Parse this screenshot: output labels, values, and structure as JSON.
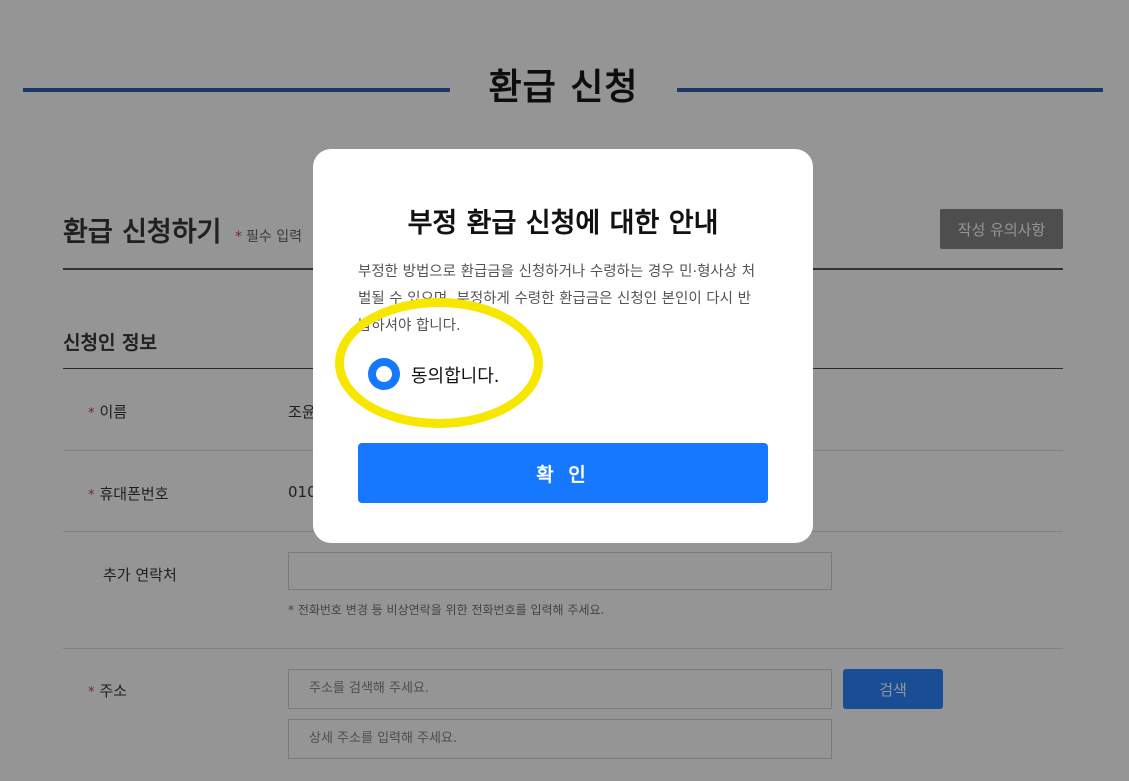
{
  "page": {
    "title": "환급 신청",
    "section_title": "환급 신청하기",
    "required_star": "*",
    "required_note": "필수 입력",
    "notice_button": "작성 유의사항",
    "subsection_title": "신청인 정보"
  },
  "form": {
    "name": {
      "label": "이름",
      "value": "조윤"
    },
    "phone": {
      "label": "휴대폰번호",
      "value": "010"
    },
    "extra_contact": {
      "label": "추가 연락처",
      "value": "",
      "hint": "* 전화번호 변경 등 비상연락을 위한 전화번호를 입력해 주세요."
    },
    "address": {
      "label": "주소",
      "search_placeholder": "주소를 검색해 주세요.",
      "detail_placeholder": "상세 주소를 입력해 주세요.",
      "search_button": "검색"
    }
  },
  "modal": {
    "title": "부정 환급 신청에 대한 안내",
    "body": "부정한 방법으로 환급금을 신청하거나 수령하는 경우 민·형사상 처벌될 수 있으며, 부정하게 수령한 환급금은 신청인 본인이 다시 반납하셔야 합니다.",
    "agree_label": "동의합니다.",
    "agree_checked": true,
    "confirm_button": "확 인"
  },
  "colors": {
    "accent": "#1677ff",
    "title_rule": "#1d4fa8",
    "required": "#d0243b",
    "highlight": "#f7e600"
  }
}
